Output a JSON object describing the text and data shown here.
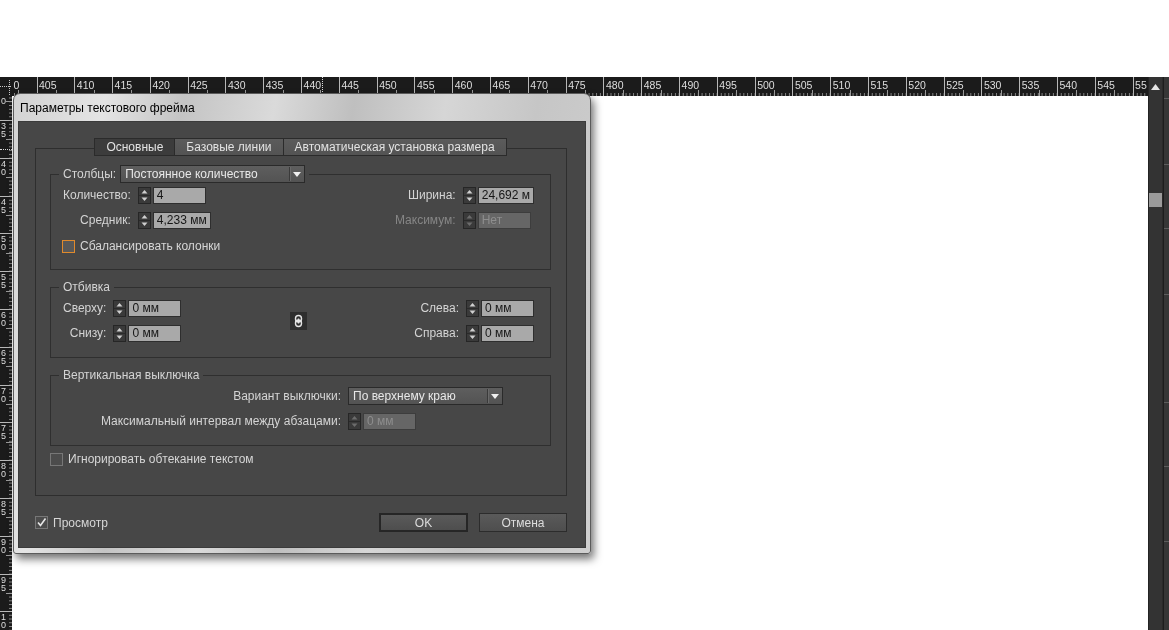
{
  "ruler": {
    "horizontal_labels": [
      "0",
      "405",
      "410",
      "415",
      "420",
      "425",
      "430",
      "435",
      "440",
      "445",
      "450",
      "455",
      "460",
      "465",
      "470",
      "475",
      "480",
      "485",
      "490",
      "495",
      "500",
      "505",
      "510",
      "515",
      "520",
      "525",
      "530",
      "535",
      "540",
      "545",
      "55"
    ],
    "vertical_labels": [
      "0",
      "35",
      "40",
      "45",
      "50",
      "55",
      "60",
      "65",
      "70",
      "75",
      "80",
      "85",
      "90",
      "95",
      "10"
    ]
  },
  "dialog": {
    "title": "Параметры текстового фрейма",
    "tabs": [
      {
        "label": "Основные",
        "selected": true
      },
      {
        "label": "Базовые линии",
        "selected": false
      },
      {
        "label": "Автоматическая установка размера",
        "selected": false
      }
    ],
    "columns": {
      "legend": "Столбцы:",
      "mode": "Постоянное количество",
      "left_fields": [
        {
          "label": "Количество:",
          "value": "4",
          "disabled": false
        },
        {
          "label": "Средник:",
          "value": "4,233 мм",
          "disabled": false
        }
      ],
      "right_fields": [
        {
          "label": "Ширина:",
          "value": "24,692 м",
          "disabled": false
        },
        {
          "label": "Максимум:",
          "value": "Нет",
          "disabled": true
        }
      ],
      "balance": {
        "label": "Сбалансировать колонки",
        "checked": false,
        "focused": true
      }
    },
    "inset": {
      "legend": "Отбивка",
      "left_fields": [
        {
          "label": "Сверху:",
          "value": "0 мм",
          "disabled": false
        },
        {
          "label": "Снизу:",
          "value": "0 мм",
          "disabled": false
        }
      ],
      "right_fields": [
        {
          "label": "Слева:",
          "value": "0 мм",
          "disabled": false
        },
        {
          "label": "Справа:",
          "value": "0 мм",
          "disabled": false
        }
      ]
    },
    "vertical_justification": {
      "legend": "Вертикальная выключка",
      "rows": [
        {
          "kind": "dropdown",
          "label": "Вариант выключки:",
          "value": "По верхнему краю",
          "disabled": false
        },
        {
          "kind": "spinner",
          "label": "Максимальный интервал между абзацами:",
          "value": "0 мм",
          "disabled": true
        }
      ]
    },
    "ignore_wrap": {
      "label": "Игнорировать обтекание текстом",
      "checked": false
    },
    "preview": {
      "label": "Просмотр",
      "checked": true
    },
    "buttons": [
      {
        "label": "OK",
        "default": true
      },
      {
        "label": "Отмена",
        "default": false
      }
    ]
  }
}
